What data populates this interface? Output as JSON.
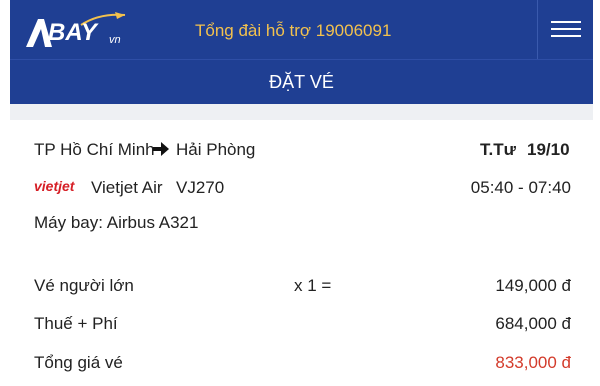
{
  "header": {
    "logo_text": "BAY",
    "logo_suffix": "vn",
    "hotline": "Tổng đài hỗ trợ 19006091"
  },
  "title": "ĐẶT VÉ",
  "flight": {
    "origin": "TP Hồ Chí Minh",
    "destination": "Hải Phòng",
    "day": "T.Tư",
    "date": "19/10",
    "airline_logo": "vietjet",
    "airline": "Vietjet Air",
    "flight_number": "VJ270",
    "time": "05:40 - 07:40",
    "aircraft": "Máy bay: Airbus A321"
  },
  "fares": {
    "adult_label": "Vé người lớn",
    "adult_qty": "x 1 =",
    "adult_price": "149,000 đ",
    "tax_label": "Thuế + Phí",
    "tax_price": "684,000 đ",
    "total_label": "Tổng giá vé",
    "total_price": "833,000 đ"
  },
  "colors": {
    "header_bg": "#1f3f93",
    "hotline": "#f2c14e",
    "total_price": "#d33b2b",
    "airline_logo": "#d61f26"
  },
  "icons": {
    "menu": "hamburger-icon",
    "route": "arrow-right-icon",
    "logo_plane": "plane-icon"
  }
}
